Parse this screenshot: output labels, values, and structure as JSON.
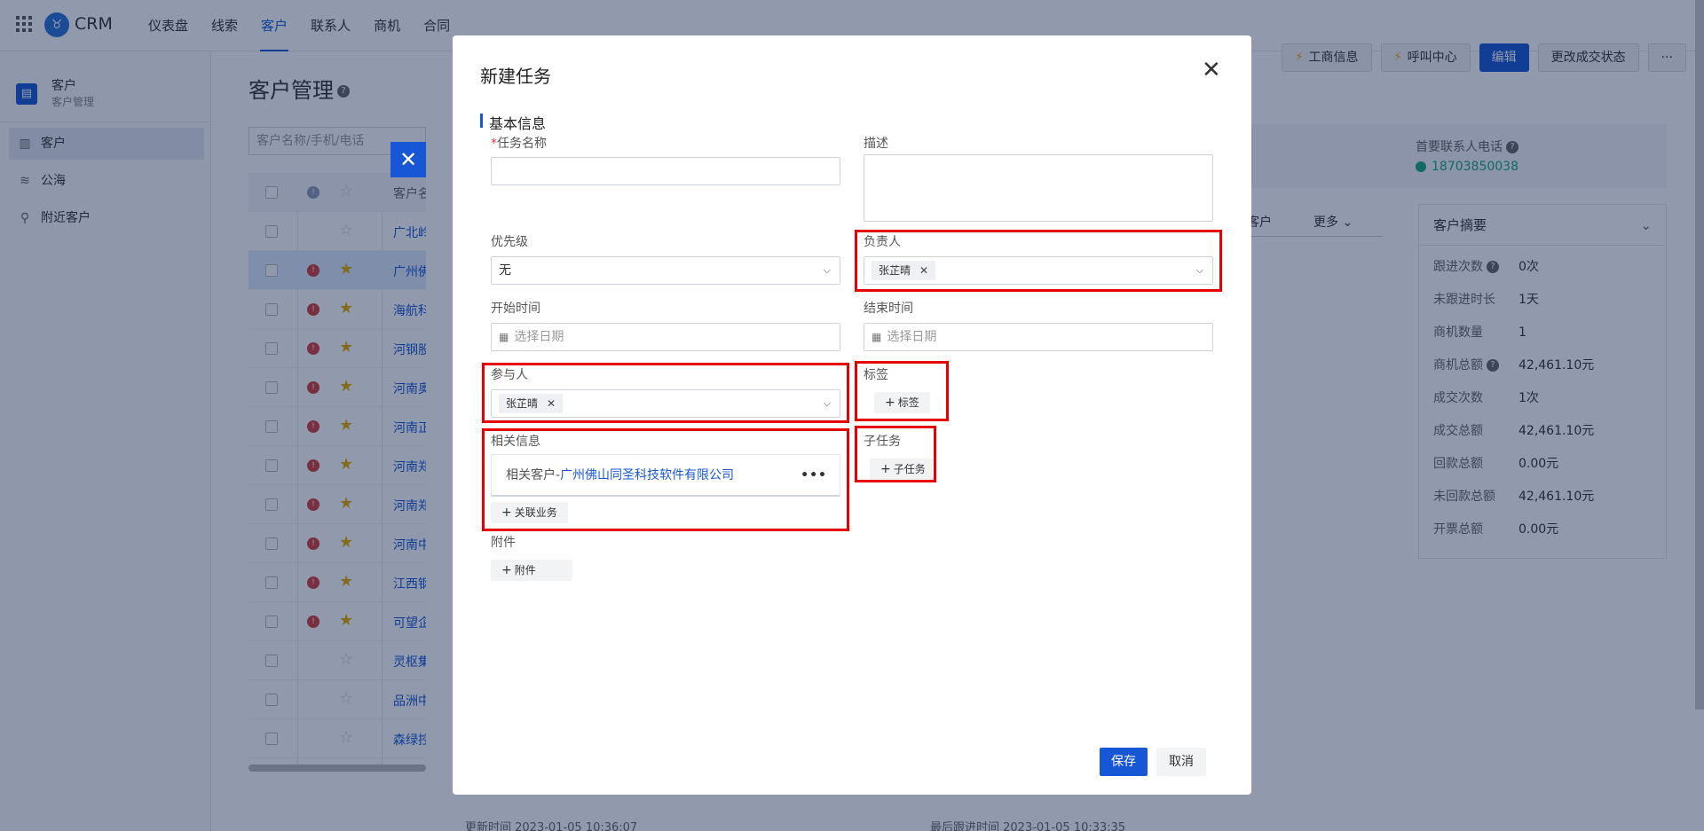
{
  "app": {
    "brand": "CRM"
  },
  "nav": [
    "仪表盘",
    "线索",
    "客户",
    "联系人",
    "商机",
    "合同"
  ],
  "breadcrumb_peek": "客户",
  "header_actions": {
    "business_info": "工商信息",
    "call_center": "呼叫中心",
    "edit": "编辑",
    "change_status": "更改成交状态",
    "more": "···"
  },
  "sidebar": {
    "title": "客户",
    "subtitle": "客户管理",
    "items": [
      "客户",
      "公海",
      "附近客户"
    ]
  },
  "main": {
    "page_title": "客户管理",
    "search_placeholder": "客户名称/手机/电话",
    "table_header": "客户名",
    "rows": [
      "广北岭",
      "广州佛",
      "海航科",
      "河钢股",
      "河南奥",
      "河南正",
      "河南郑",
      "河南郑",
      "河南中",
      "江西钢",
      "可望企",
      "灵枢集",
      "品洲中",
      "森绿控"
    ]
  },
  "detail": {
    "phone_label": "首要联系人电话",
    "phone_value": "18703850038",
    "tab_ke": "客户",
    "tab_more": "更多",
    "summary_title": "客户摘要",
    "summary": [
      {
        "k": "跟进次数",
        "v": "0次",
        "help": true
      },
      {
        "k": "未跟进时长",
        "v": "1天",
        "help": false
      },
      {
        "k": "商机数量",
        "v": "1",
        "help": false
      },
      {
        "k": "商机总额",
        "v": "42,461.10元",
        "help": true
      },
      {
        "k": "成交次数",
        "v": "1次",
        "help": false
      },
      {
        "k": "成交总额",
        "v": "42,461.10元",
        "help": false
      },
      {
        "k": "回款总额",
        "v": "0.00元",
        "help": false
      },
      {
        "k": "未回款总额",
        "v": "42,461.10元",
        "help": false
      },
      {
        "k": "开票总额",
        "v": "0.00元",
        "help": false
      }
    ],
    "bottom_left": "更新时间    2023-01-05 10:36:07",
    "bottom_right": "最后跟进时间    2023-01-05 10:33:35"
  },
  "modal": {
    "title": "新建任务",
    "section": "基本信息",
    "task_name_label": "任务名称",
    "description_label": "描述",
    "priority_label": "优先级",
    "priority_value": "无",
    "owner_label": "负责人",
    "owner_tag": "张芷晴",
    "start_label": "开始时间",
    "start_placeholder": "选择日期",
    "end_label": "结束时间",
    "end_placeholder": "选择日期",
    "participants_label": "参与人",
    "participant_tag": "张芷晴",
    "tags_label": "标签",
    "add_tag": "标签",
    "related_label": "相关信息",
    "related_prefix": "相关客户-",
    "related_link": "广州佛山同圣科技软件有限公司",
    "link_business": "关联业务",
    "subtask_label": "子任务",
    "add_subtask": "子任务",
    "attachment_label": "附件",
    "add_attachment": "附件",
    "save": "保存",
    "cancel": "取消"
  }
}
